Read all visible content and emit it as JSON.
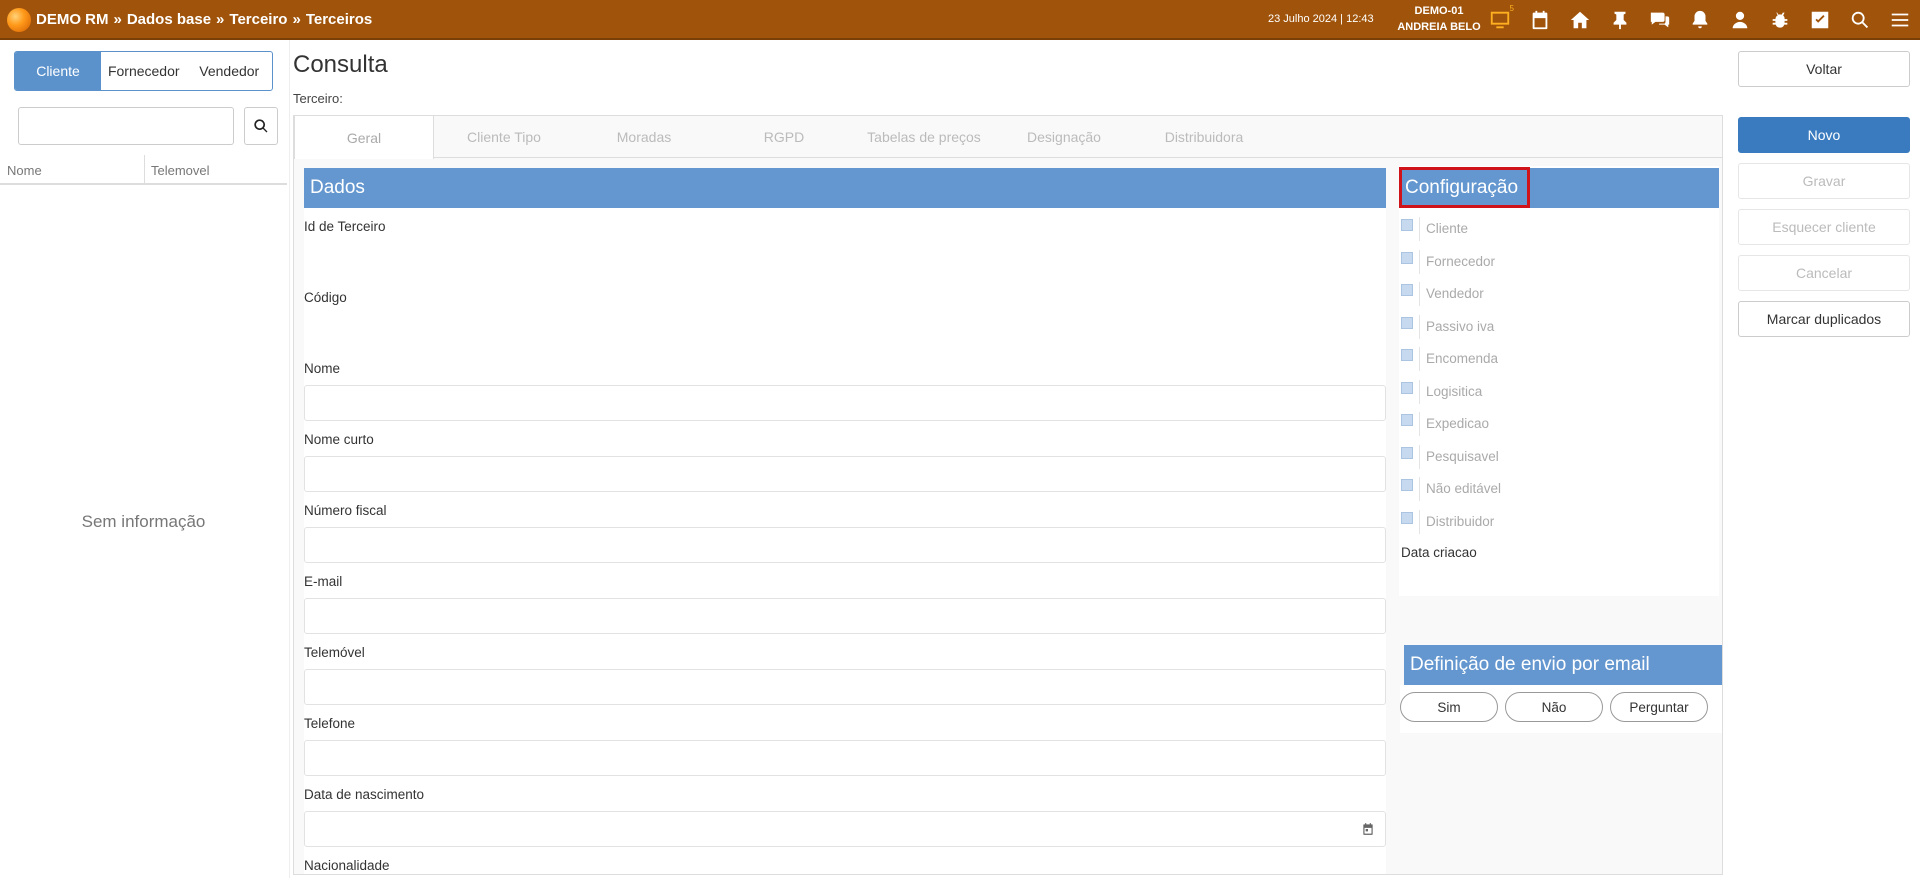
{
  "topbar": {
    "breadcrumb": [
      "DEMO RM",
      "Dados base",
      "Terceiro",
      "Terceiros"
    ],
    "breadcrumb_sep": "»",
    "datetime": "23 Julho 2024 | 12:43",
    "company": "DEMO-01",
    "user": "ANDREIA BELO",
    "monitor_badge": "5",
    "icons": [
      "monitor-icon",
      "calendar-icon",
      "home-icon",
      "pin-icon",
      "chat-icon",
      "bell-icon",
      "user-icon",
      "bug-icon",
      "checkbox-icon",
      "search-icon",
      "menu-icon"
    ],
    "accent": "#a0540b"
  },
  "left": {
    "segments": [
      "Cliente",
      "Fornecedor",
      "Vendedor"
    ],
    "search_value": "",
    "columns": [
      "Nome",
      "Telemovel"
    ],
    "empty_text": "Sem informação"
  },
  "main": {
    "title": "Consulta",
    "subtitle": "Terceiro:",
    "tabs": [
      "Geral",
      "Cliente Tipo",
      "Moradas",
      "RGPD",
      "Tabelas de preços",
      "Designação",
      "Distribuidora"
    ],
    "dados": {
      "heading": "Dados",
      "fields": {
        "id": "Id de Terceiro",
        "codigo": "Código",
        "nome": "Nome",
        "nome_curto": "Nome curto",
        "nif": "Número fiscal",
        "email": "E-mail",
        "telemovel": "Telemóvel",
        "telefone": "Telefone",
        "nascimento": "Data de nascimento",
        "nacionalidade": "Nacionalidade"
      }
    },
    "config": {
      "heading": "Configuração",
      "options": [
        "Cliente",
        "Fornecedor",
        "Vendedor",
        "Passivo iva",
        "Encomenda",
        "Logisitica",
        "Expedicao",
        "Pesquisavel",
        "Não editável",
        "Distribuidor"
      ],
      "data_criacao": "Data criacao"
    },
    "email_def": {
      "heading": "Definição de envio por email",
      "options": [
        "Sim",
        "Não",
        "Perguntar"
      ]
    },
    "header_color": "#6497cf"
  },
  "right": {
    "voltar": "Voltar",
    "novo": "Novo",
    "gravar": "Gravar",
    "esquecer": "Esquecer cliente",
    "cancelar": "Cancelar",
    "duplicados": "Marcar duplicados"
  }
}
